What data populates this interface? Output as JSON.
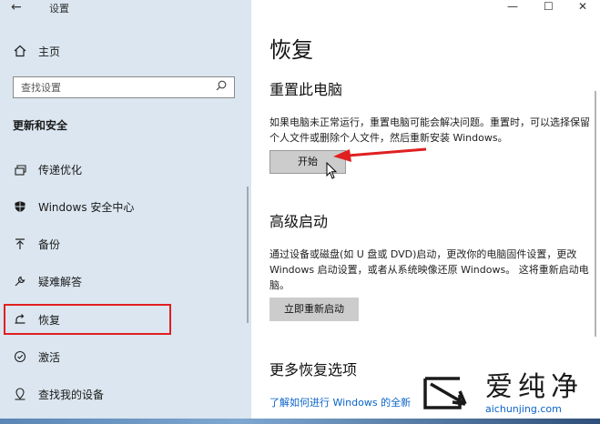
{
  "window": {
    "title": "设置",
    "back_symbol": "←",
    "minimize_symbol": "—",
    "maximize_symbol": "☐",
    "close_symbol": "✕"
  },
  "sidebar": {
    "home_label": "主页",
    "home_icon": "home-icon",
    "search_placeholder": "查找设置",
    "section_title": "更新和安全",
    "items": [
      {
        "label": "传递优化",
        "icon": "delivery-optimization-icon"
      },
      {
        "label": "Windows 安全中心",
        "icon": "shield-icon"
      },
      {
        "label": "备份",
        "icon": "backup-arrow-icon"
      },
      {
        "label": "疑难解答",
        "icon": "wrench-icon"
      },
      {
        "label": "恢复",
        "icon": "recovery-icon",
        "selected": true
      },
      {
        "label": "激活",
        "icon": "activation-check-icon"
      },
      {
        "label": "查找我的设备",
        "icon": "find-device-icon"
      }
    ]
  },
  "main": {
    "title": "恢复",
    "reset": {
      "heading": "重置此电脑",
      "description": "如果电脑未正常运行，重置电脑可能会解决问题。重置时，可以选择保留个人文件或删除个人文件，然后重新安装 Windows。",
      "button": "开始"
    },
    "advanced": {
      "heading": "高级启动",
      "description": "通过设备或磁盘(如 U 盘或 DVD)启动，更改你的电脑固件设置，更改 Windows 启动设置，或者从系统映像还原 Windows。 这将重新启动电脑。",
      "button": "立即重新启动"
    },
    "more": {
      "heading": "更多恢复选项",
      "link": "了解如何进行 Windows 的全新"
    }
  },
  "watermark": {
    "name": "爱纯净",
    "url": "aichunjing.com"
  },
  "colors": {
    "sidebar_bg": "#dbe6f0",
    "highlight_box": "#e02020",
    "annotation_arrow": "#e02020",
    "link": "#0a63c9",
    "button_bg": "#cccccc"
  }
}
